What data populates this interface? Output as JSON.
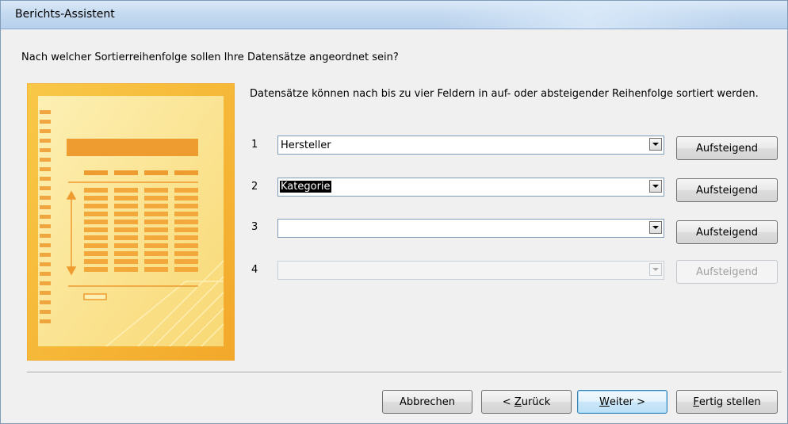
{
  "window": {
    "title": "Berichts-Assistent"
  },
  "question": "Nach welcher Sortierreihenfolge sollen Ihre Datensätze angeordnet sein?",
  "description": "Datensätze können nach bis zu vier Feldern in auf- oder absteigender Reihenfolge sortiert werden.",
  "sort_rows": [
    {
      "number": "1",
      "field": "Hersteller",
      "order_label": "Aufsteigend",
      "enabled": true,
      "selected": false
    },
    {
      "number": "2",
      "field": "Kategorie",
      "order_label": "Aufsteigend",
      "enabled": true,
      "selected": true
    },
    {
      "number": "3",
      "field": "",
      "order_label": "Aufsteigend",
      "enabled": true,
      "selected": false
    },
    {
      "number": "4",
      "field": "",
      "order_label": "Aufsteigend",
      "enabled": false,
      "selected": false
    }
  ],
  "footer": {
    "cancel": "Abbrechen",
    "back_prefix": "< ",
    "back_mnemonic": "Z",
    "back_rest": "urück",
    "next_mnemonic": "W",
    "next_rest": "eiter >",
    "finish_mnemonic": "F",
    "finish_rest": "ertig stellen"
  },
  "icons": {
    "dropdown": "chevron-down-icon",
    "illustration": "report-sort-illustration"
  },
  "colors": {
    "illustration_bg": "#f6b836",
    "illustration_page": "#fbe69a",
    "illustration_bar": "#ee9b2f",
    "titlebar": "#c5daf0",
    "default_button_border": "#3c7fb1"
  }
}
